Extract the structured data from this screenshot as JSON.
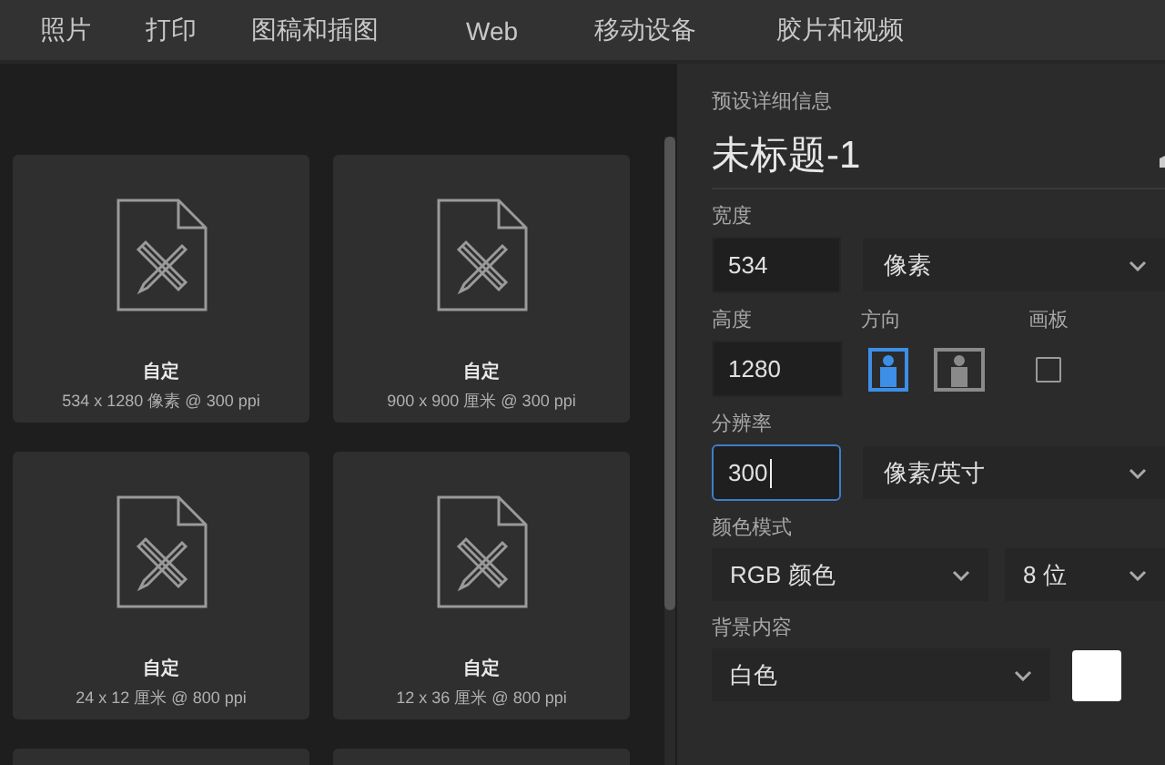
{
  "tabs": [
    {
      "label": "照片"
    },
    {
      "label": "打印"
    },
    {
      "label": "图稿和插图"
    },
    {
      "label": "Web"
    },
    {
      "label": "移动设备"
    },
    {
      "label": "胶片和视频"
    }
  ],
  "presets": [
    {
      "name": "自定",
      "size": "534 x 1280 像素 @ 300 ppi"
    },
    {
      "name": "自定",
      "size": "900 x 900 厘米 @ 300 ppi"
    },
    {
      "name": "自定",
      "size": "24 x 12 厘米 @ 800 ppi"
    },
    {
      "name": "自定",
      "size": "12 x 36 厘米 @ 800 ppi"
    }
  ],
  "details": {
    "heading": "预设详细信息",
    "title": "未标题-1",
    "width": {
      "label": "宽度",
      "value": "534",
      "unit": "像素"
    },
    "height": {
      "label": "高度",
      "value": "1280"
    },
    "orientation": {
      "label": "方向",
      "options": [
        {
          "kind": "portrait",
          "selected": true
        },
        {
          "kind": "landscape",
          "selected": false
        }
      ]
    },
    "artboard": {
      "label": "画板",
      "checked": false
    },
    "resolution": {
      "label": "分辨率",
      "value": "300",
      "focused": true,
      "unit": "像素/英寸"
    },
    "color_mode": {
      "label": "颜色模式",
      "mode": "RGB 颜色",
      "depth": "8 位"
    },
    "background": {
      "label": "背景内容",
      "value": "白色",
      "color": "#ffffff"
    }
  }
}
